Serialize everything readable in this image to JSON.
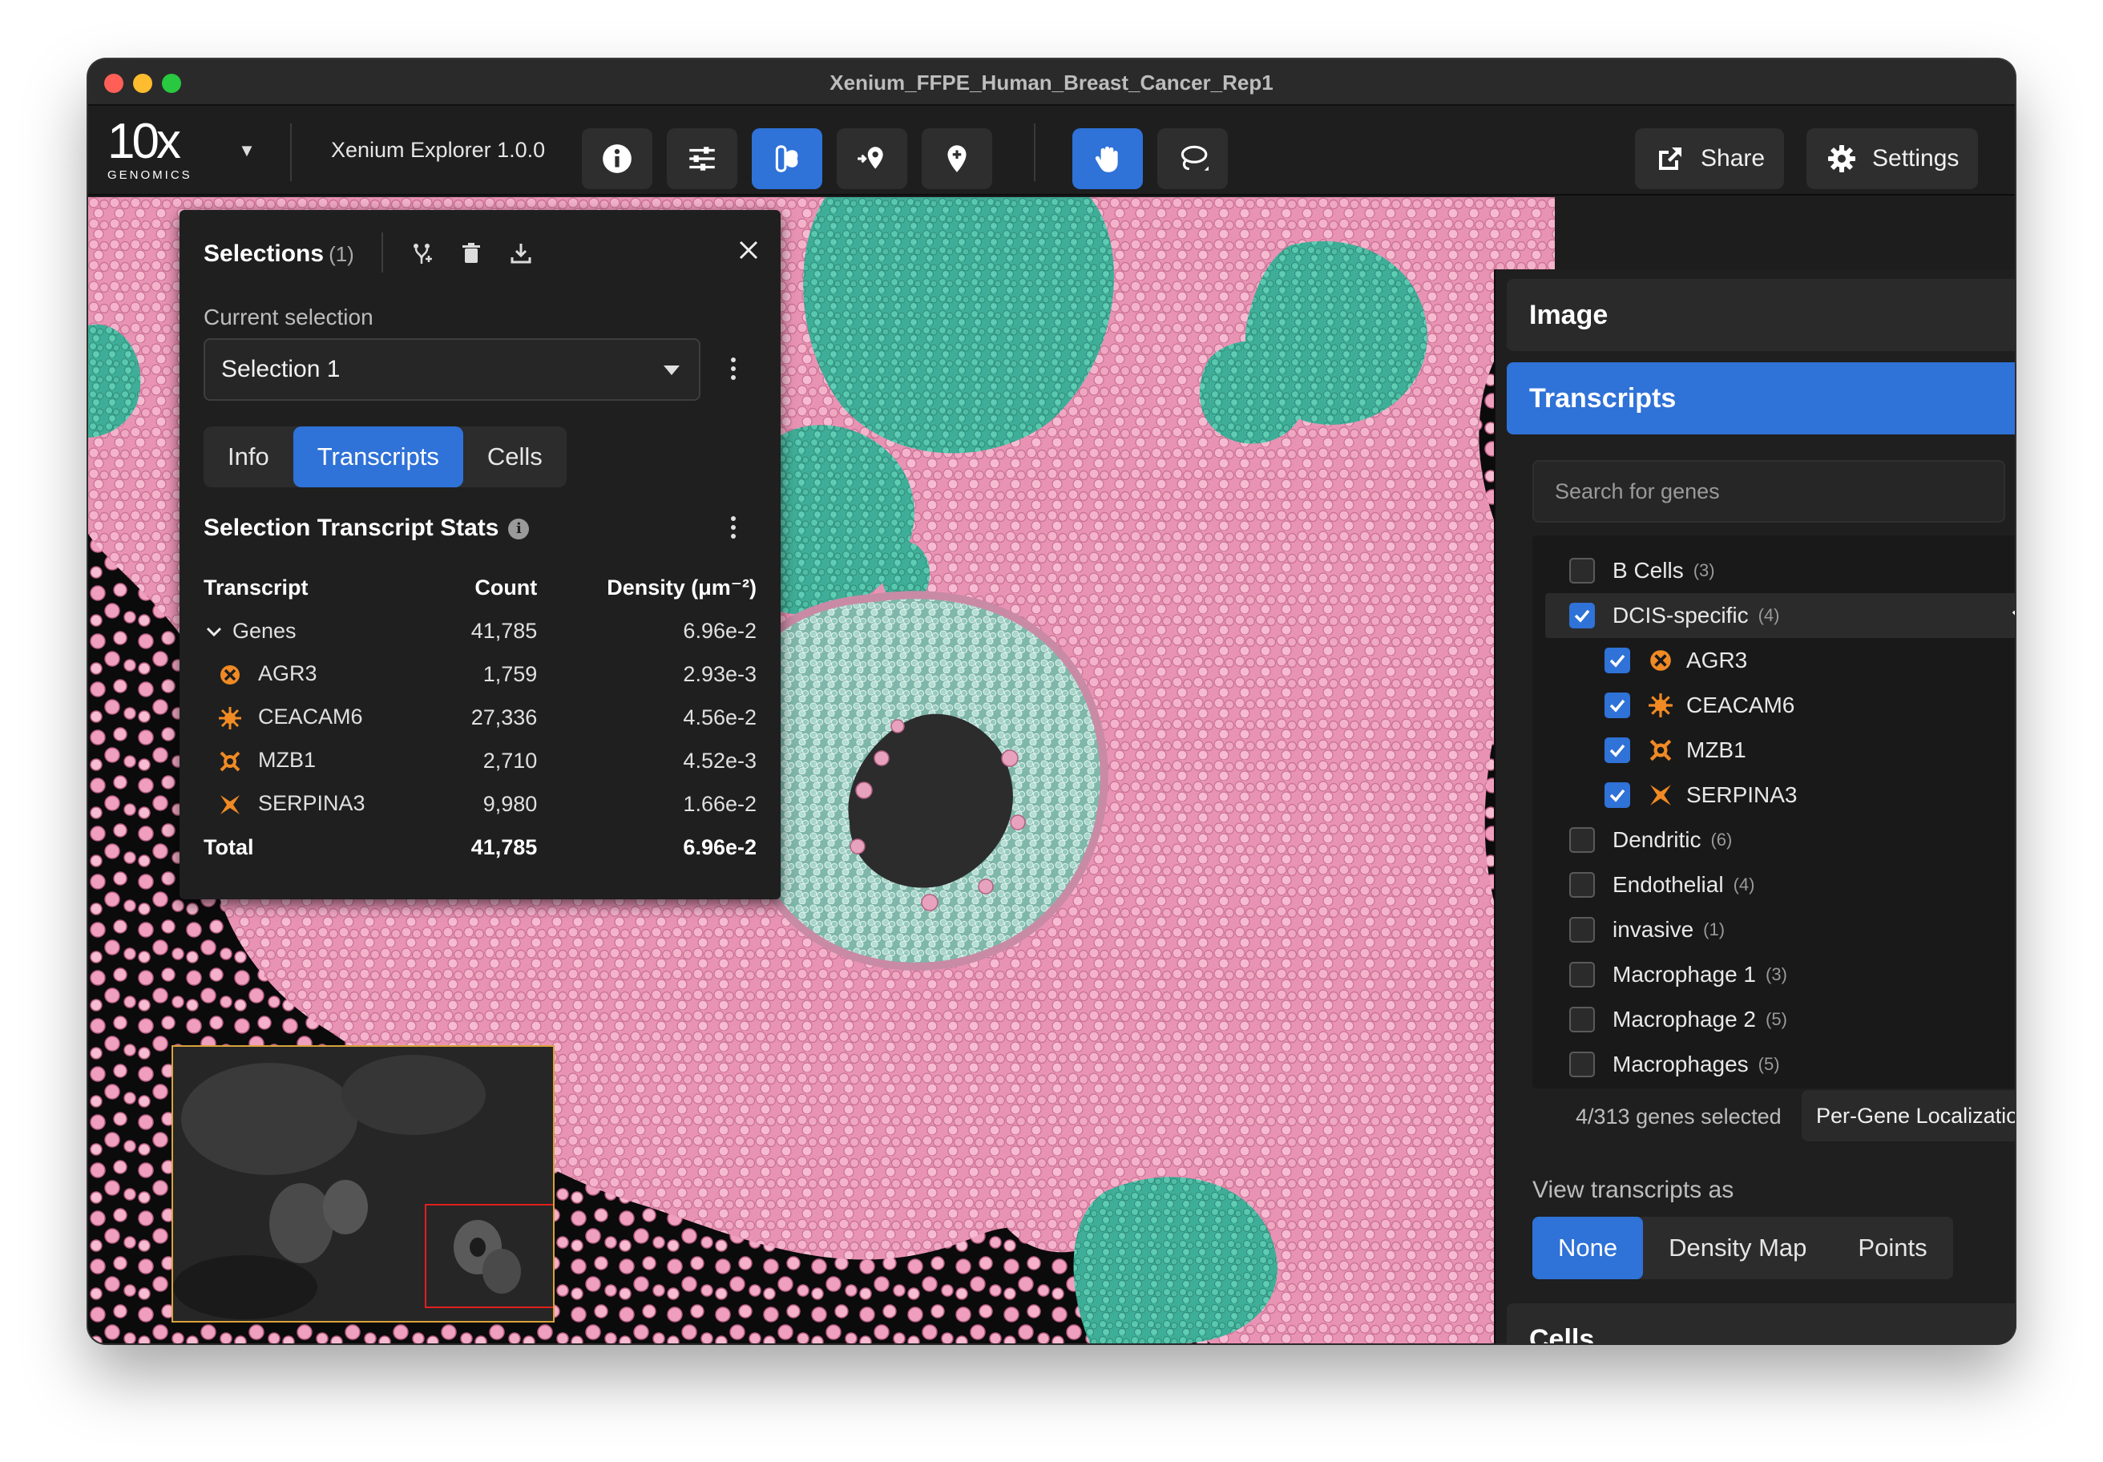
{
  "window": {
    "title": "Xenium_FFPE_Human_Breast_Cancer_Rep1"
  },
  "toolbar": {
    "logo_main": "10x",
    "logo_sub": "GENOMICS",
    "app_name": "Xenium Explorer 1.0.0",
    "share_label": "Share",
    "settings_label": "Settings"
  },
  "selections": {
    "title": "Selections",
    "count": "(1)",
    "current_label": "Current selection",
    "current_value": "Selection 1",
    "tabs": [
      {
        "label": "Info",
        "active": false
      },
      {
        "label": "Transcripts",
        "active": true
      },
      {
        "label": "Cells",
        "active": false
      }
    ],
    "stats_title": "Selection Transcript Stats",
    "columns": {
      "transcript": "Transcript",
      "count": "Count",
      "density": "Density (μm⁻²)"
    },
    "genes_row": {
      "label": "Genes",
      "count": "41,785",
      "density": "6.96e-2"
    },
    "rows": [
      {
        "name": "AGR3",
        "count": "1,759",
        "density": "2.93e-3",
        "icon": "x-circle-icon"
      },
      {
        "name": "CEACAM6",
        "count": "27,336",
        "density": "4.56e-2",
        "icon": "sun-burst-icon"
      },
      {
        "name": "MZB1",
        "count": "2,710",
        "density": "4.52e-3",
        "icon": "ring-burst-icon"
      },
      {
        "name": "SERPINA3",
        "count": "9,980",
        "density": "1.66e-2",
        "icon": "bowtie-x-icon"
      }
    ],
    "total": {
      "label": "Total",
      "count": "41,785",
      "density": "6.96e-2"
    }
  },
  "right_panel": {
    "image_header": "Image",
    "transcripts_header": "Transcripts",
    "search_placeholder": "Search for genes",
    "groups": [
      {
        "label": "B Cells",
        "count": "(3)",
        "checked": false,
        "expanded": false
      },
      {
        "label": "DCIS-specific",
        "count": "(4)",
        "checked": true,
        "expanded": true,
        "children": [
          {
            "label": "AGR3",
            "checked": true,
            "icon": "x-circle-icon"
          },
          {
            "label": "CEACAM6",
            "checked": true,
            "icon": "sun-burst-icon"
          },
          {
            "label": "MZB1",
            "checked": true,
            "icon": "ring-burst-icon"
          },
          {
            "label": "SERPINA3",
            "checked": true,
            "icon": "bowtie-x-icon"
          }
        ]
      },
      {
        "label": "Dendritic",
        "count": "(6)",
        "checked": false,
        "expanded": false
      },
      {
        "label": "Endothelial",
        "count": "(4)",
        "checked": false,
        "expanded": false
      },
      {
        "label": "invasive",
        "count": "(1)",
        "checked": false,
        "expanded": false
      },
      {
        "label": "Macrophage 1",
        "count": "(3)",
        "checked": false,
        "expanded": false
      },
      {
        "label": "Macrophage 2",
        "count": "(5)",
        "checked": false,
        "expanded": false
      },
      {
        "label": "Macrophages",
        "count": "(5)",
        "checked": false,
        "expanded": false
      }
    ],
    "genes_selected": "4/313 genes selected",
    "per_gene_button": "Per-Gene Localization",
    "view_as_label": "View transcripts as",
    "view_options": [
      {
        "label": "None",
        "active": true
      },
      {
        "label": "Density Map",
        "active": false
      },
      {
        "label": "Points",
        "active": false
      }
    ],
    "cells_header": "Cells"
  },
  "colors": {
    "accent": "#2f72d8",
    "gene_icon": "#f08a24",
    "cell_pink": "#f2a6c2",
    "cell_teal": "#4fc0a8"
  }
}
